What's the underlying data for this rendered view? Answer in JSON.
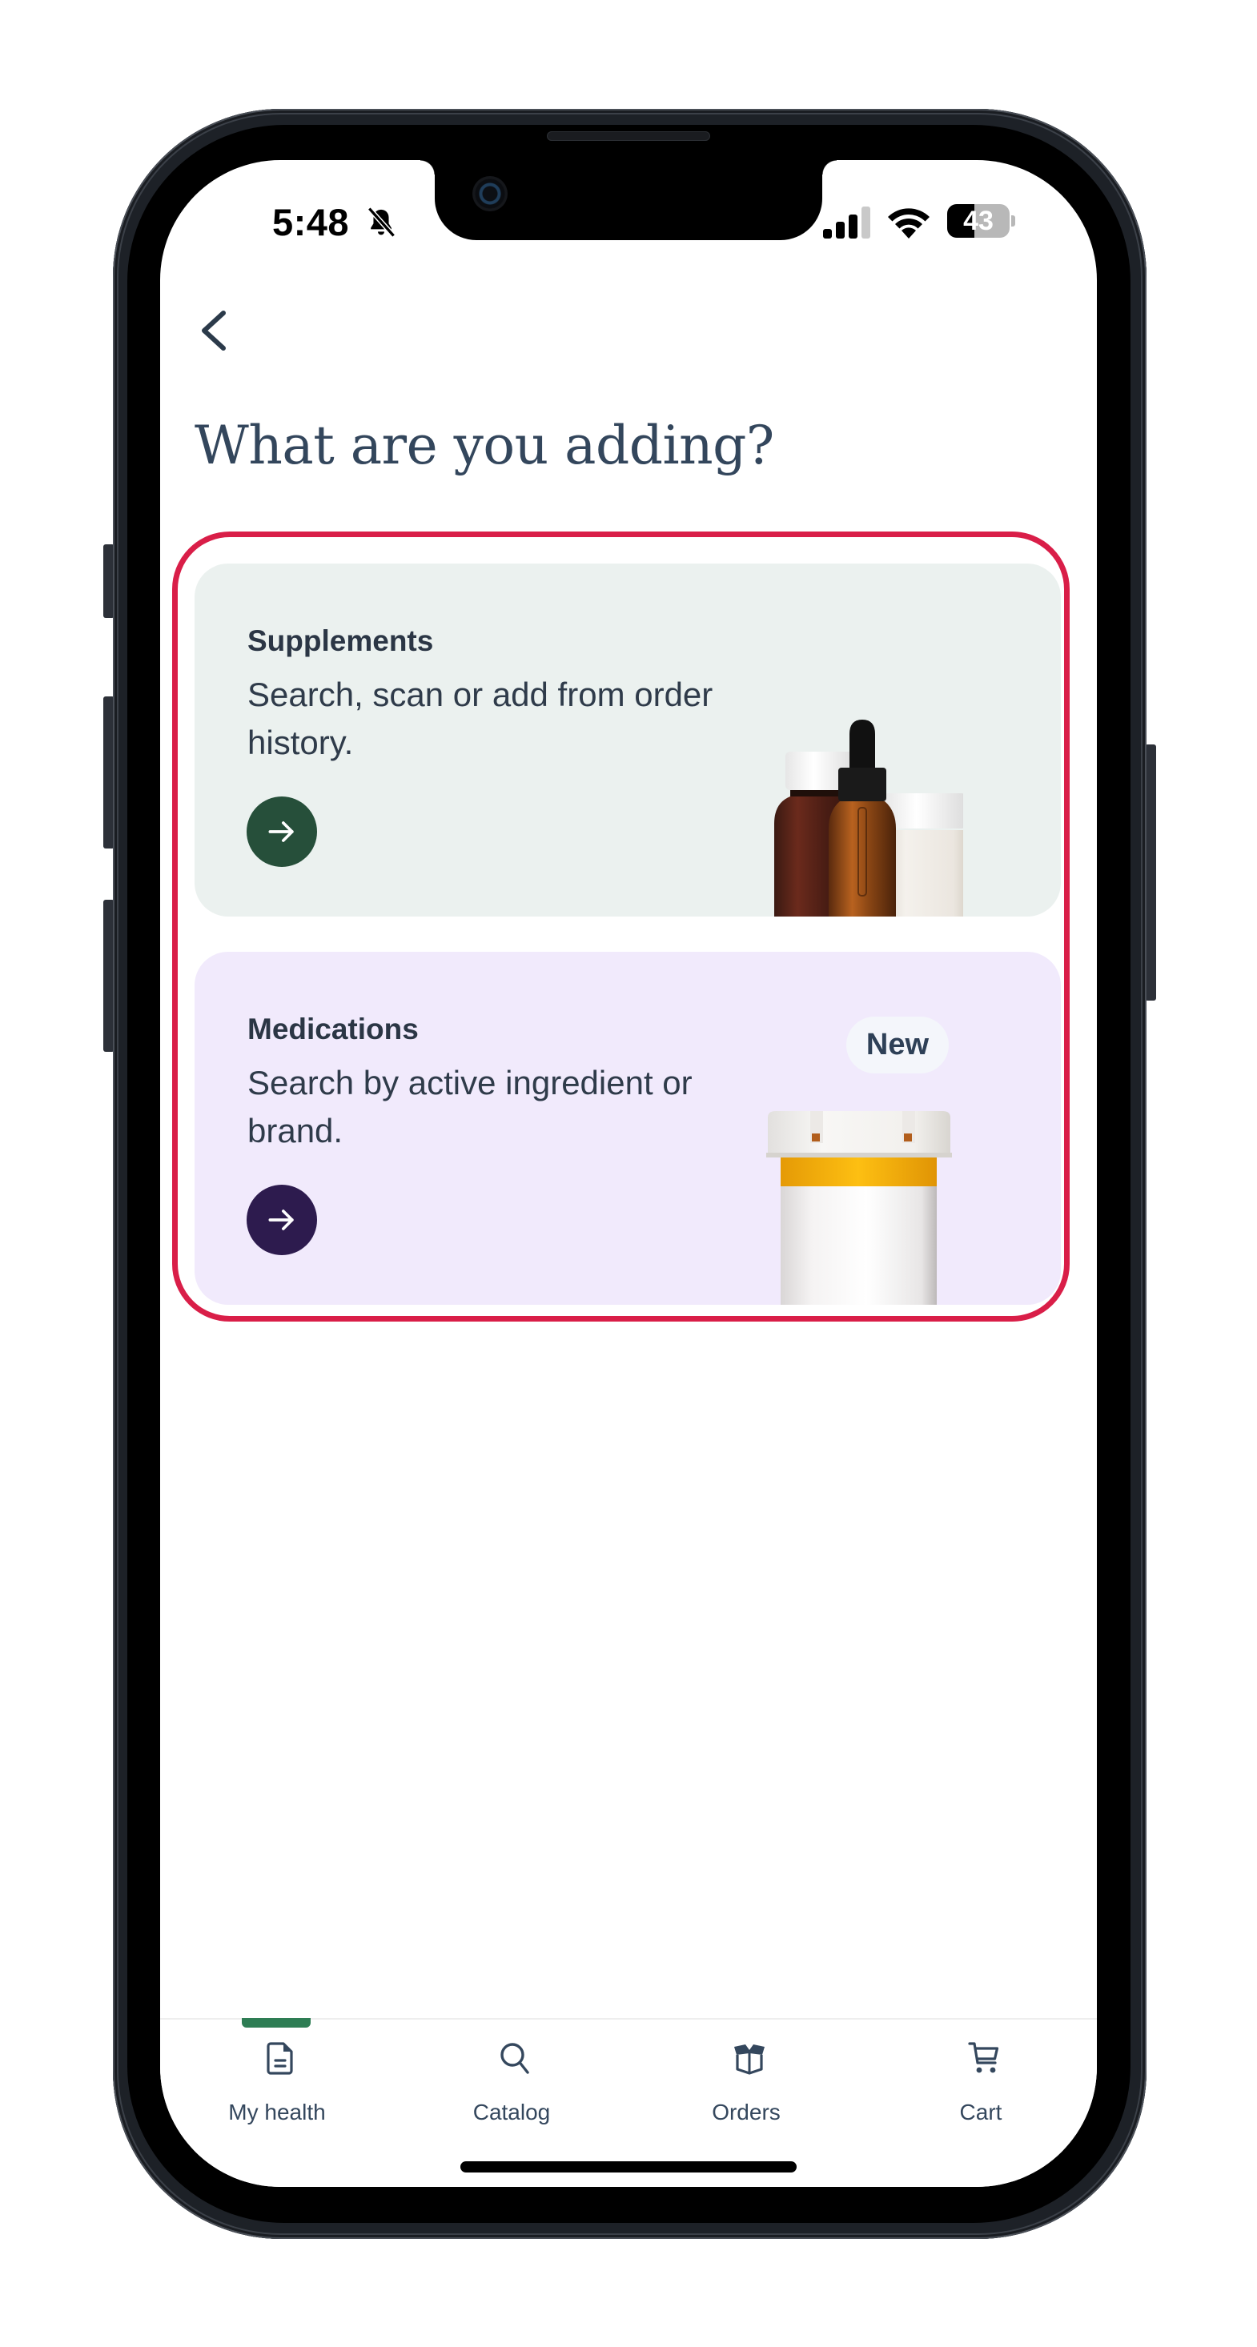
{
  "status_bar": {
    "time": "5:48",
    "silent_icon": "bell-slash-icon",
    "signal_icon": "cellular-signal-icon",
    "signal_bars": 3,
    "signal_bars_total": 4,
    "wifi_icon": "wifi-icon",
    "battery_icon": "battery-icon",
    "battery_percent": 43,
    "battery_label": "43"
  },
  "header": {
    "back_icon": "chevron-left-icon",
    "title": "What are you adding?"
  },
  "options": [
    {
      "id": "supplements",
      "title": "Supplements",
      "description": "Search, scan or add from order history.",
      "button_icon": "arrow-right-icon",
      "image": "supplement-bottles-image",
      "background": "#ebf1ef",
      "accent": "#264f3a"
    },
    {
      "id": "medications",
      "title": "Medications",
      "description": "Search by active ingredient or brand.",
      "badge": "New",
      "button_icon": "arrow-right-icon",
      "image": "prescription-bottle-image",
      "background": "#f1eafc",
      "accent": "#2d1b4e"
    }
  ],
  "highlight_color": "#d91e48",
  "bottom_nav": {
    "active_color": "#2e7d54",
    "items": [
      {
        "label": "My health",
        "icon": "document-icon",
        "active": true
      },
      {
        "label": "Catalog",
        "icon": "search-icon",
        "active": false
      },
      {
        "label": "Orders",
        "icon": "open-box-icon",
        "active": false
      },
      {
        "label": "Cart",
        "icon": "cart-icon",
        "active": false
      }
    ]
  }
}
